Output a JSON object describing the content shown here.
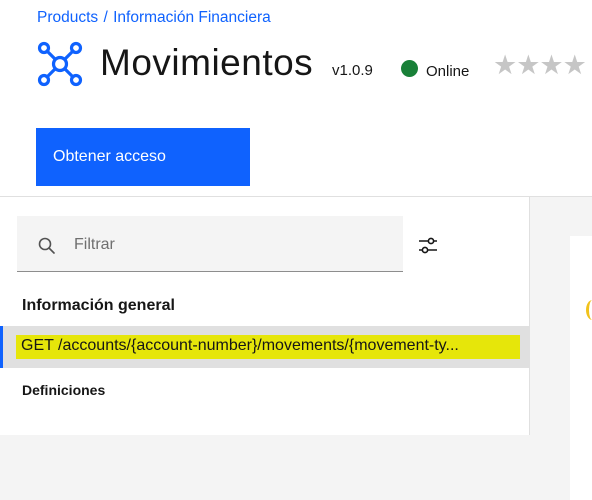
{
  "breadcrumb": {
    "items": [
      "Products",
      "Información Financiera"
    ],
    "separator": "/"
  },
  "api": {
    "title": "Movimientos",
    "version": "v1.0.9",
    "status": "Online",
    "status_color": "#198038",
    "stars_glyph": "★★★★",
    "rating": 0,
    "icon": "api-network-icon"
  },
  "actions": {
    "access_label": "Obtener acceso"
  },
  "search": {
    "placeholder": "Filtrar",
    "value": ""
  },
  "nav": {
    "section_title": "Información general",
    "operation": "GET /accounts/{account-number}/movements/{movement-ty...",
    "definitions": "Definiciones"
  },
  "colors": {
    "accent": "#0f62fe",
    "highlight": "#e6e60a",
    "status": "#198038"
  }
}
